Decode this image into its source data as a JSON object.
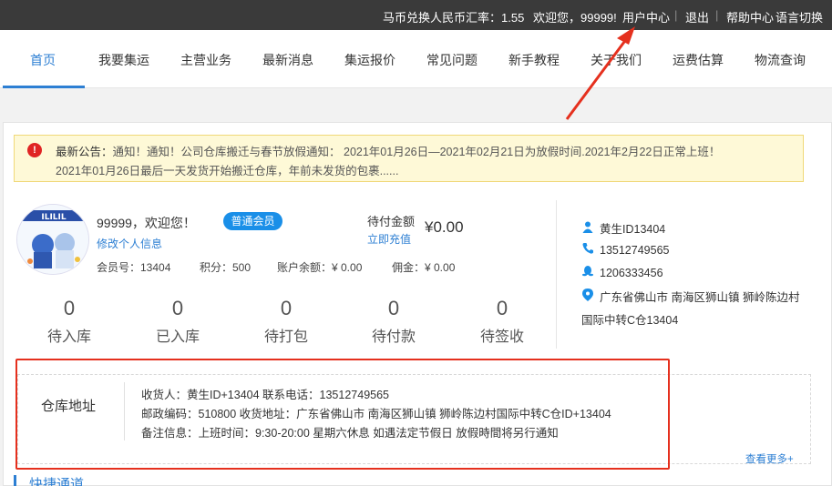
{
  "topbar": {
    "rate": "马币兑换人民币汇率：1.55",
    "welcome": "欢迎您，99999!",
    "user_center": "用户中心",
    "sep": "|",
    "logout": "退出",
    "help": "帮助中心",
    "lang": "语言切换"
  },
  "nav": {
    "items": [
      "首页",
      "我要集运",
      "主营业务",
      "最新消息",
      "集运报价",
      "常见问题",
      "新手教程",
      "关于我们",
      "运费估算",
      "物流查询"
    ]
  },
  "notice": {
    "icon": "!",
    "line1_prefix": "最新公告：",
    "line1": "通知！通知！公司仓库搬迁与春节放假通知： 2021年01月26日—2021年02月21日为放假时间.2021年2月22日正常上班！",
    "line2": "2021年01月26日最后一天发货开始搬迁仓库，年前未发货的包裹......"
  },
  "profile": {
    "avatar_text": "ILILIL",
    "greeting": "99999，欢迎您！",
    "badge": "普通会员",
    "edit": "修改个人信息",
    "pending_label": "待付金额",
    "recharge": "立即充值",
    "pending_amount": "¥0.00",
    "member_no": "会员号：13404",
    "points": "积分：500",
    "balance": "账户余额：¥ 0.00",
    "commission": "佣金：¥ 0.00"
  },
  "counters": [
    {
      "num": "0",
      "label": "待入库"
    },
    {
      "num": "0",
      "label": "已入库"
    },
    {
      "num": "0",
      "label": "待打包"
    },
    {
      "num": "0",
      "label": "待付款"
    },
    {
      "num": "0",
      "label": "待签收"
    }
  ],
  "contact": {
    "name": "黄生ID13404",
    "phone": "13512749565",
    "qq": "1206333456",
    "address1": "广东省佛山市 南海区狮山镇 狮岭陈边村",
    "address2": "国际中转C仓13404"
  },
  "warehouse": {
    "title": "仓库地址",
    "line1": "收货人：黄生ID+13404  联系电话：13512749565",
    "line2": "邮政编码：510800      收货地址：广东省佛山市 南海区狮山镇 狮岭陈边村国际中转C仓ID+13404",
    "line3": "备注信息：上班时间：9:30-20:00 星期六休息 如遇法定节假日 放假時間将另行通知",
    "more": "查看更多+"
  },
  "quick": {
    "title": "快捷通道"
  },
  "colors": {
    "accent": "#2d7fd3",
    "highlight": "#e5301e",
    "badge": "#1a8fe8"
  }
}
